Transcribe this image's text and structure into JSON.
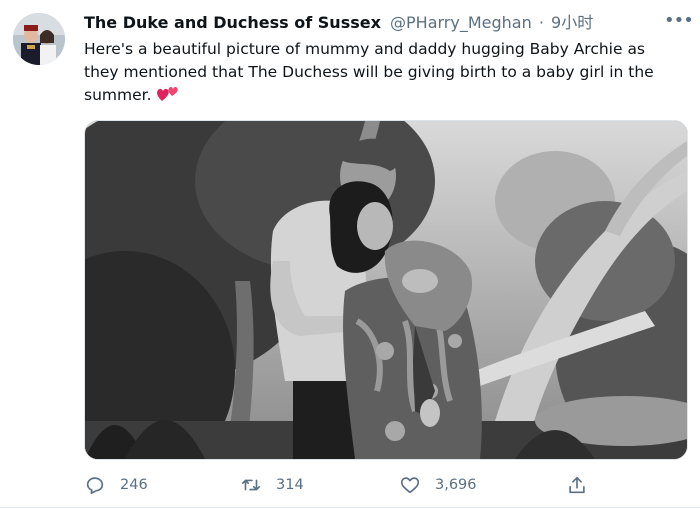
{
  "tweet": {
    "author_name": "The Duke and Duchess of Sussex",
    "handle": "@PHarry_Meghan",
    "separator": "·",
    "time": "9小时",
    "more_label": "•••",
    "text": "Here's a beautiful picture of mummy and daddy hugging Baby Archie as they mentioned that The Duchess will be giving birth to a baby girl in the summer.",
    "emoji": "two-hearts-icon"
  },
  "actions": {
    "reply_count": "246",
    "retweet_count": "314",
    "like_count": "3,696"
  },
  "colors": {
    "text": "#0f1419",
    "secondary": "#5b7083",
    "heart": "#e0245e"
  }
}
